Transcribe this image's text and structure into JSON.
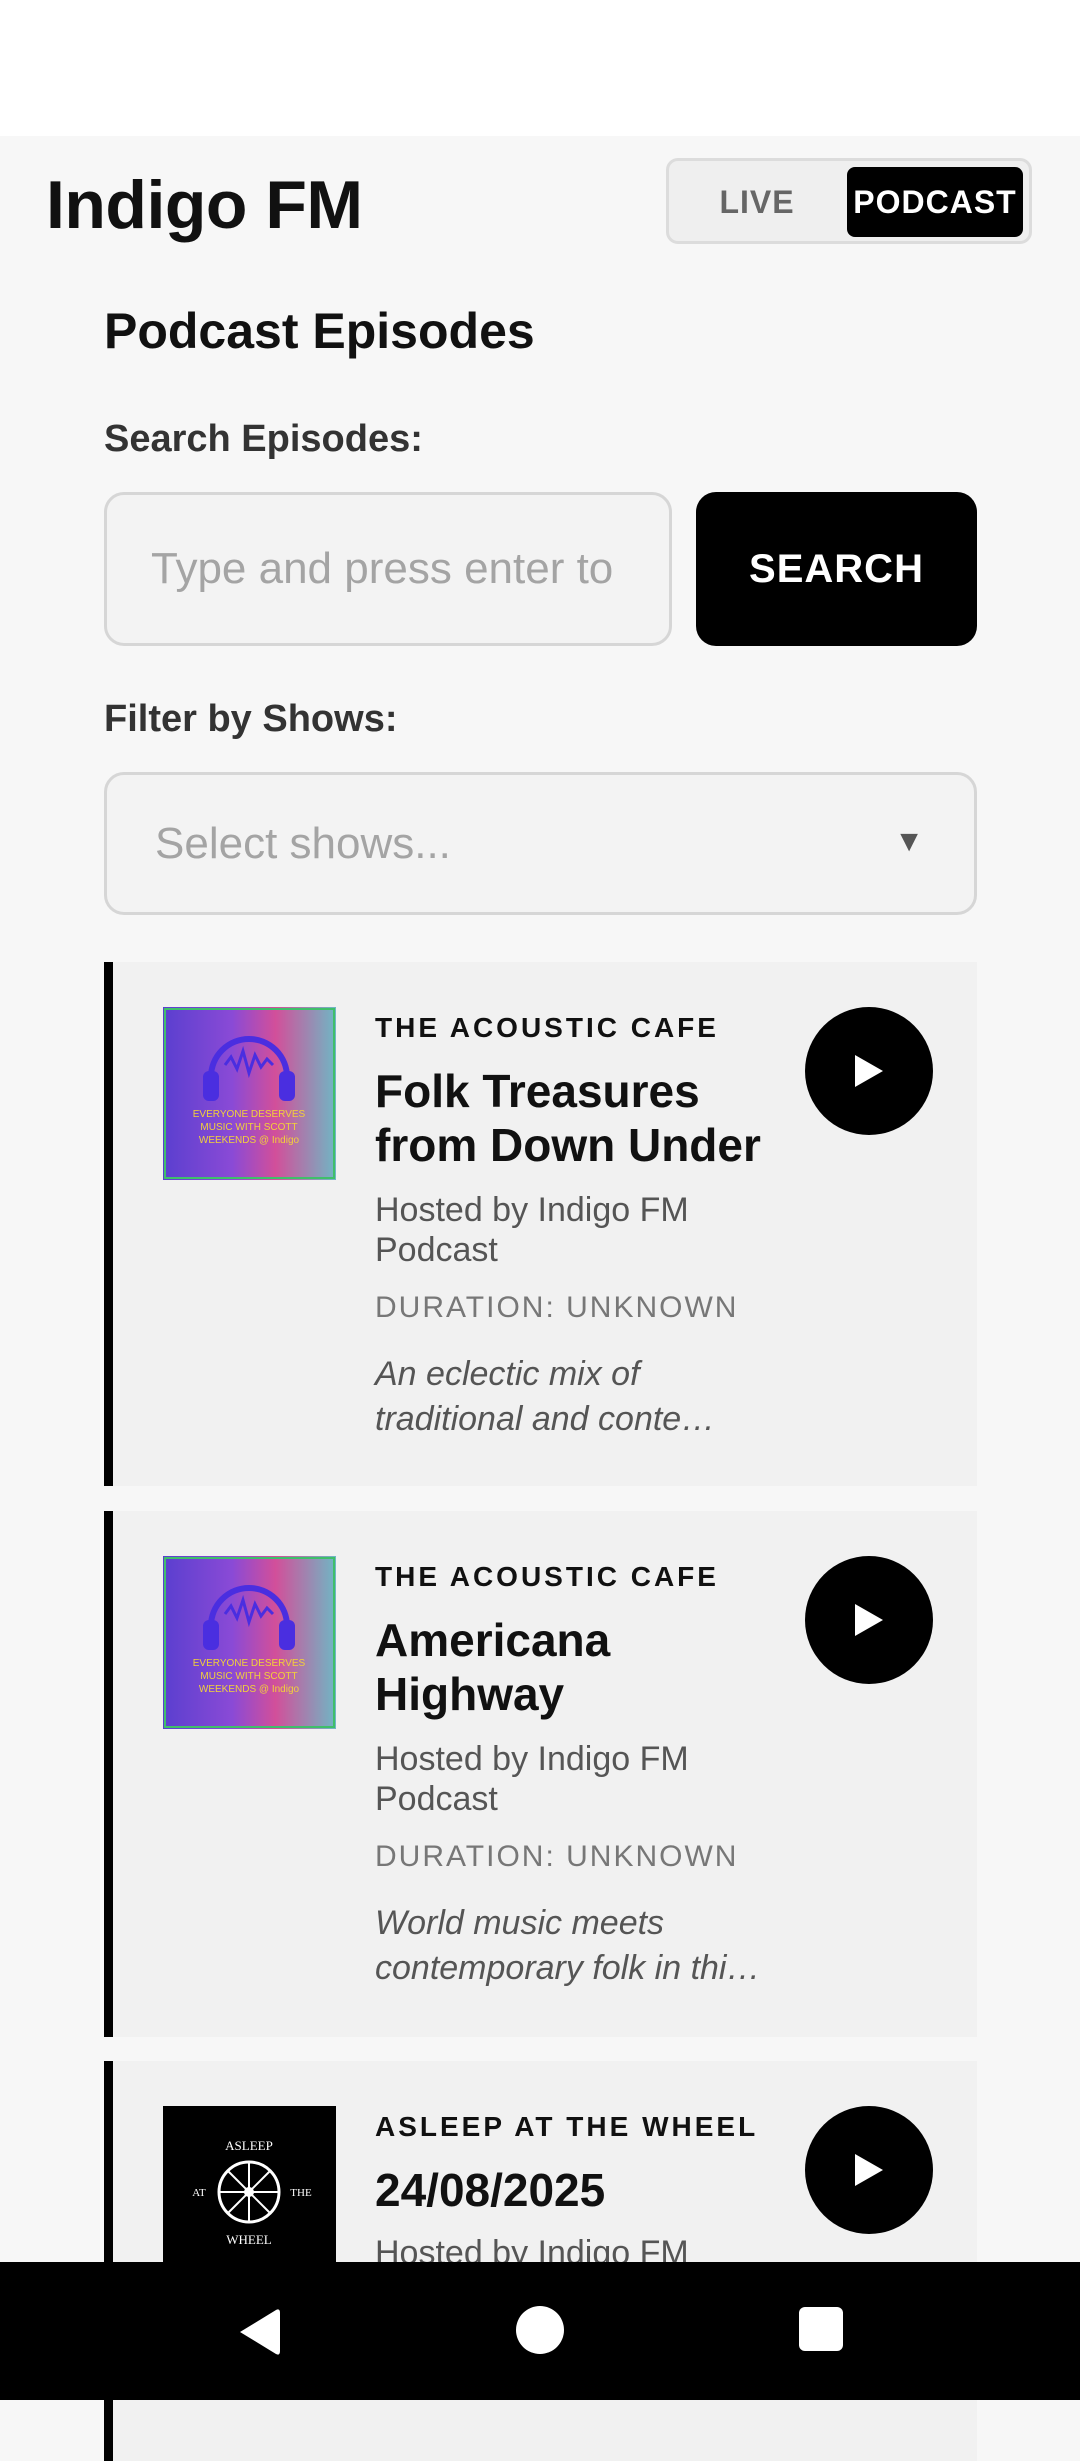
{
  "app": {
    "title": "Indigo FM"
  },
  "mode_toggle": {
    "live": "LIVE",
    "podcast": "PODCAST",
    "selected": "PODCAST"
  },
  "section": {
    "title": "Podcast Episodes"
  },
  "search": {
    "label": "Search Episodes:",
    "placeholder": "Type and press enter to search",
    "value": "",
    "button": "SEARCH"
  },
  "filter": {
    "label": "Filter by Shows:",
    "placeholder": "Select shows...",
    "arrow": "▼"
  },
  "episodes": [
    {
      "show": "THE ACOUSTIC CAFE",
      "title": "Folk Treasures from Down Under",
      "host": "Hosted by Indigo FM Podcast",
      "duration": "DURATION: UNKNOWN",
      "description": "An eclectic mix of traditional and conte…",
      "thumbnail_icon": "headphones-artwork",
      "thumbnail_text": "EVERYONE DESERVES MUSIC WITH SCOTT WEEKENDS @ Indigo"
    },
    {
      "show": "THE ACOUSTIC CAFE",
      "title": "Americana Highway",
      "host": "Hosted by Indigo FM Podcast",
      "duration": "DURATION: UNKNOWN",
      "description": "World music meets contemporary folk in thi…",
      "thumbnail_icon": "headphones-artwork",
      "thumbnail_text": "EVERYONE DESERVES MUSIC WITH SCOTT WEEKENDS @ Indigo"
    },
    {
      "show": "ASLEEP AT THE WHEEL",
      "title": "24/08/2025",
      "host": "Hosted by Indigo FM",
      "thumbnail_icon": "wagon-wheel-logo",
      "thumbnail_text": "ASLEEP AT THE WHEEL"
    }
  ],
  "colors": {
    "accent": "#000000",
    "background": "#f7f7f7",
    "card": "#f1f1f1"
  },
  "nav_icons": [
    "back-icon",
    "home-icon",
    "recents-icon"
  ]
}
